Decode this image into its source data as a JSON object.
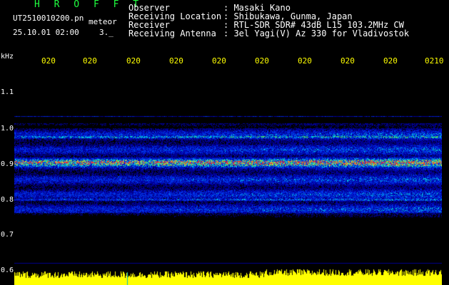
{
  "header": {
    "app_title": "H R O F F T",
    "filename": "UT2510010200.pn",
    "mode": "meteor",
    "datetime": "25.10.01 02:00",
    "speed": "3._",
    "fields": [
      {
        "label": "Observer",
        "value": ": Masaki Kano"
      },
      {
        "label": "Receiving Location",
        "value": ": Shibukawa, Gunma, Japan"
      },
      {
        "label": "Receiver",
        "value": ": RTL-SDR SDR# 43dB L15 103.2MHz CW"
      },
      {
        "label": "Receiving Antenna",
        "value": ": 3el Yagi(V) Az 330 for Vladivostok"
      }
    ]
  },
  "axis": {
    "unit": "kHz",
    "y_ticks": [
      "1.1",
      "1.0",
      "0.9",
      "0.8",
      "0.7",
      "0.6"
    ],
    "x_ticks": [
      "020",
      "020",
      "020",
      "020",
      "020",
      "020",
      "020",
      "020",
      "020",
      "0210"
    ]
  },
  "colors": {
    "title": "#20ff40",
    "text": "#ffffff",
    "time_labels": "#ffff00",
    "signal_band": "#ff2020",
    "noise_bar": "#ffff00",
    "grid": "#000090"
  }
}
